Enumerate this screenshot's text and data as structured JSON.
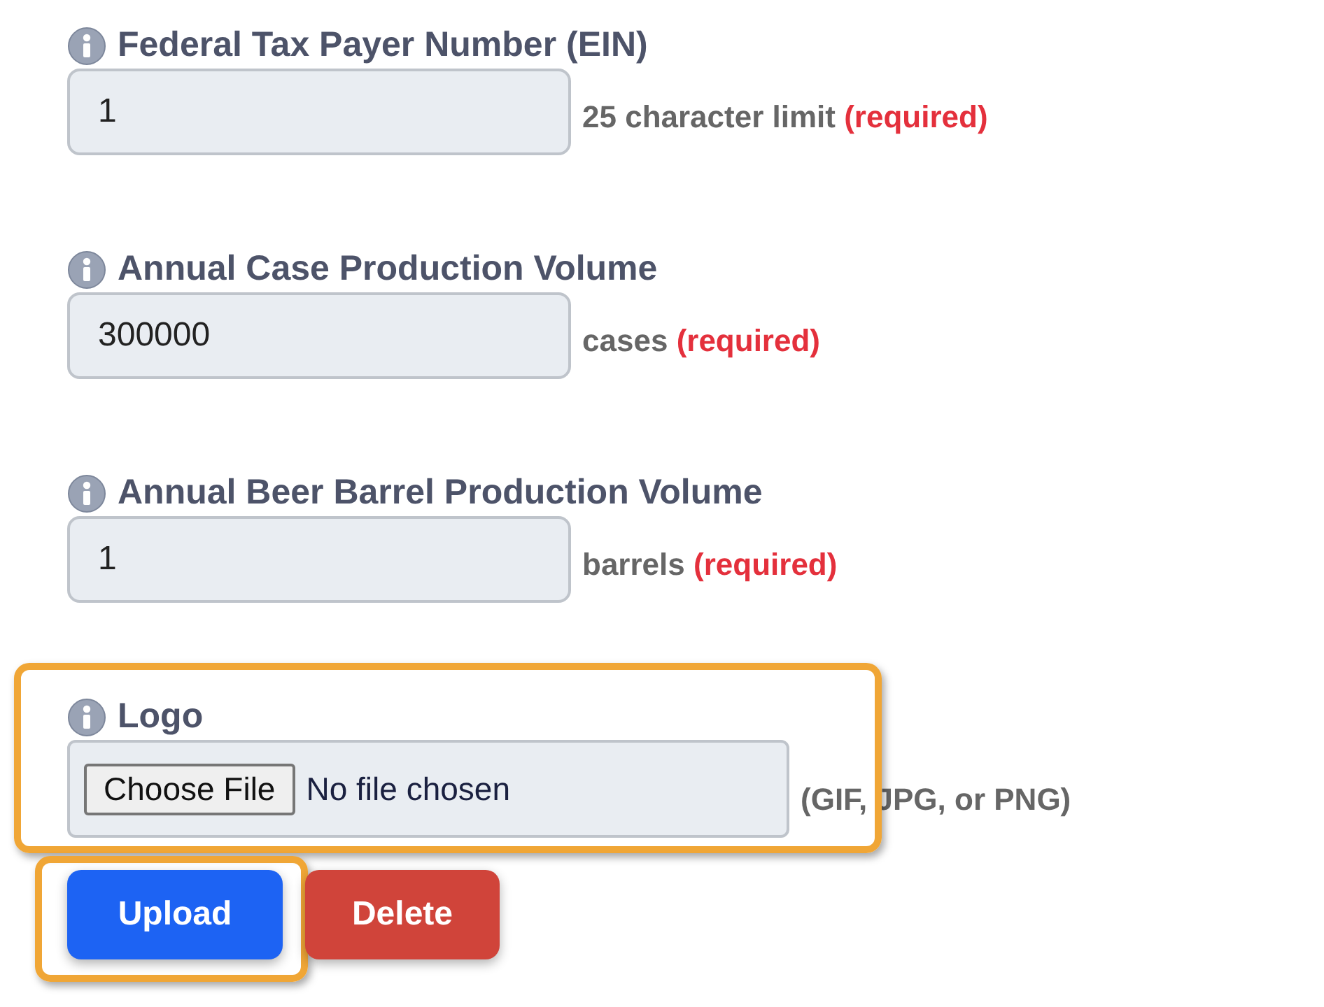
{
  "fields": [
    {
      "kind": "text",
      "label": "Federal Tax Payer Number (EIN)",
      "value": "1",
      "hint": "25 character limit",
      "required": "(required)",
      "highlighted": false
    },
    {
      "kind": "text",
      "label": "Annual Case Production Volume",
      "value": "300000",
      "hint": "cases",
      "required": "(required)",
      "highlighted": false
    },
    {
      "kind": "text",
      "label": "Annual Beer Barrel Production Volume",
      "value": "1",
      "hint": "barrels",
      "required": "(required)",
      "highlighted": false
    },
    {
      "kind": "file",
      "label": "Logo",
      "button": "Choose File",
      "status": "No file chosen",
      "hint": "(GIF, JPG, or PNG)",
      "highlighted": true
    }
  ],
  "buttons": [
    {
      "kind": "primary",
      "label": "Upload",
      "highlighted": true
    },
    {
      "kind": "danger",
      "label": "Delete",
      "highlighted": false
    }
  ]
}
